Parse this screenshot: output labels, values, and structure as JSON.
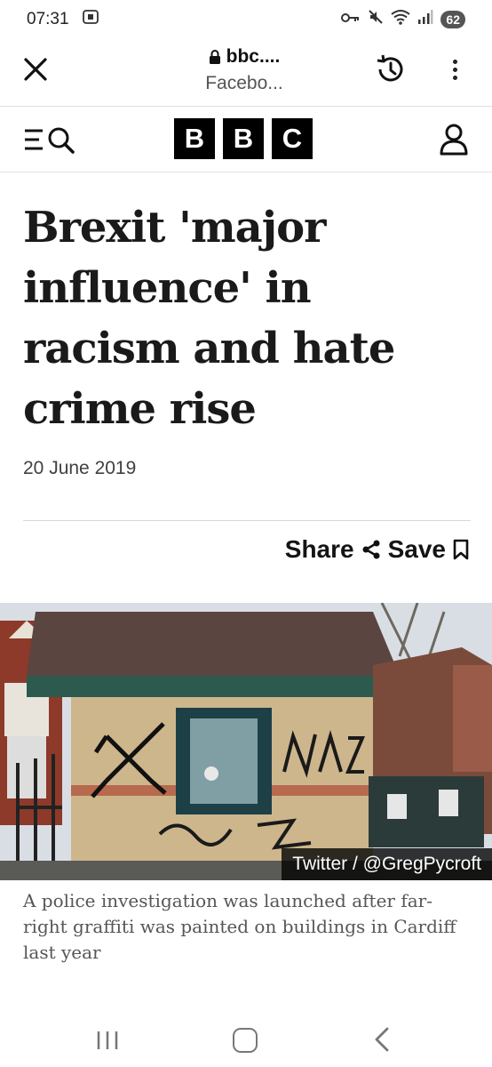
{
  "status_bar": {
    "time": "07:31",
    "battery": "62",
    "icons": [
      "screenshot-icon",
      "vpn-key-icon",
      "mute-icon",
      "wifi-icon",
      "signal-icon"
    ]
  },
  "browser": {
    "url": "bbc....",
    "page_source": "Facebo...",
    "icons": [
      "close-icon",
      "lock-icon",
      "history-icon",
      "more-vert-icon"
    ]
  },
  "bbc_nav": {
    "logo_letters": [
      "B",
      "B",
      "C"
    ],
    "icons": [
      "menu-icon",
      "search-icon",
      "account-icon"
    ]
  },
  "article": {
    "headline_lines": [
      "Brexit 'major",
      "influence' in",
      "racism and hate",
      "crime rise"
    ],
    "date": "20 June 2019",
    "share_label": "Share",
    "save_label": "Save",
    "image_credit": "Twitter / @GregPycroft",
    "caption": "A police investigation was launched after far-right graffiti was painted on buildings in Cardiff last year"
  },
  "colors": {
    "text": "#141414",
    "caption": "#545658",
    "date": "#404040"
  }
}
